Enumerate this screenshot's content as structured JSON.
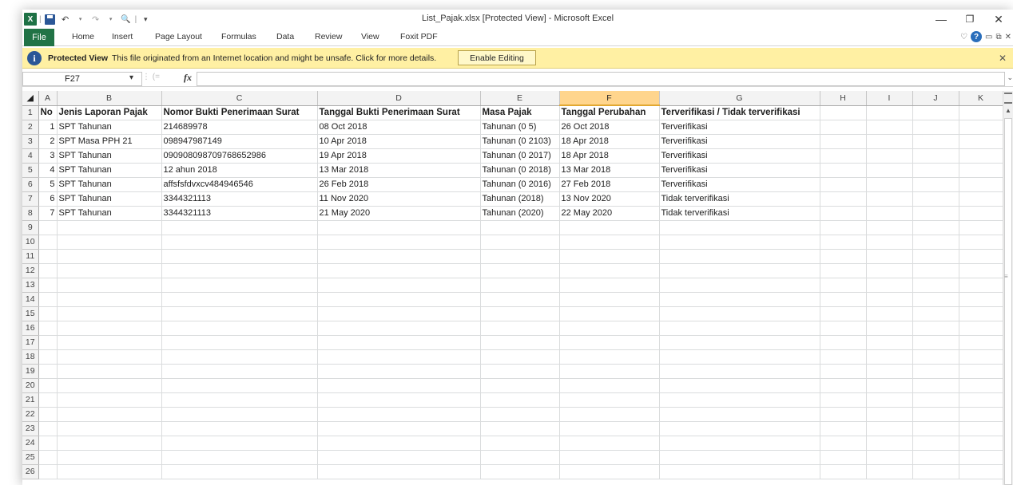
{
  "window": {
    "title": "List_Pajak.xlsx  [Protected View] - Microsoft Excel",
    "controls": [
      "—",
      "❐",
      "✕"
    ]
  },
  "qat": {
    "logo": "X",
    "undo": "↶",
    "redo": "↷",
    "print_preview": "🔍",
    "customize": "▾"
  },
  "ribbon": {
    "file_tab": "File",
    "tabs": [
      "Home",
      "Insert",
      "Page Layout",
      "Formulas",
      "Data",
      "Review",
      "View",
      "Foxit PDF"
    ],
    "right_icons": [
      "♡",
      "?",
      "▭",
      "⧉",
      "✕"
    ]
  },
  "protected_view": {
    "title": "Protected View",
    "message": "This file originated from an Internet location and might be unsafe. Click for more details.",
    "button": "Enable Editing",
    "close": "✕",
    "icon": "i"
  },
  "formula_bar": {
    "name_box": "F27",
    "fx": "fx",
    "value": ""
  },
  "grid": {
    "columns": [
      "A",
      "B",
      "C",
      "D",
      "E",
      "F",
      "G",
      "H",
      "I",
      "J",
      "K"
    ],
    "selected_column": "F",
    "headers": [
      "No",
      "Jenis Laporan Pajak",
      "Nomor Bukti Penerimaan Surat",
      "Tanggal Bukti Penerimaan Surat",
      "Masa Pajak",
      "Tanggal Perubahan",
      "Terverifikasi / Tidak terverifikasi"
    ],
    "rows": [
      [
        "1",
        "SPT Tahunan",
        "214689978",
        "08 Oct 2018",
        "Tahunan (0 5)",
        "26 Oct 2018",
        "Terverifikasi"
      ],
      [
        "2",
        "SPT Masa PPH 21",
        "098947987149",
        "10 Apr 2018",
        "Tahunan (0 2103)",
        "18 Apr 2018",
        "Terverifikasi"
      ],
      [
        "3",
        "SPT Tahunan",
        "090908098709768652986",
        "19 Apr 2018",
        "Tahunan (0 2017)",
        "18 Apr 2018",
        "Terverifikasi"
      ],
      [
        "4",
        "SPT Tahunan",
        "12 ahun 2018",
        "13 Mar 2018",
        "Tahunan (0 2018)",
        "13 Mar 2018",
        "Terverifikasi"
      ],
      [
        "5",
        "SPT Tahunan",
        "affsfsfdvxcv484946546",
        "26 Feb 2018",
        "Tahunan (0 2016)",
        "27 Feb 2018",
        "Terverifikasi"
      ],
      [
        "6",
        "SPT Tahunan",
        "3344321113",
        "11 Nov 2020",
        "Tahunan (2018)",
        "13 Nov 2020",
        "Tidak terverifikasi"
      ],
      [
        "7",
        "SPT Tahunan",
        "3344321113",
        "21 May 2020",
        "Tahunan (2020)",
        "22 May 2020",
        "Tidak terverifikasi"
      ]
    ],
    "row_numbers": [
      "1",
      "2",
      "3",
      "4",
      "5",
      "6",
      "7",
      "8",
      "9",
      "10",
      "11",
      "12",
      "13",
      "14",
      "15",
      "16",
      "17",
      "18",
      "19",
      "20",
      "21",
      "22",
      "23",
      "24",
      "25",
      "26"
    ]
  },
  "colors": {
    "file_tab": "#217346",
    "protected_bar": "#fff0a3",
    "selected_header": "#ffd58d"
  }
}
